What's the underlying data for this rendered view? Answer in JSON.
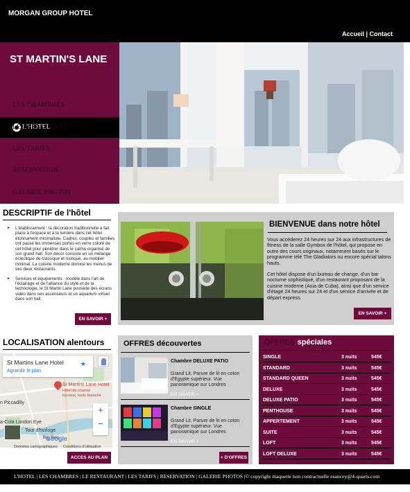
{
  "header": {
    "brand": "MORGAN GROUP HOTEL",
    "links": [
      "Accueil",
      "Contact"
    ],
    "separator": " | "
  },
  "sidebar": {
    "title": "ST MARTIN'S LANE",
    "active": "L'HOTEL",
    "items": [
      "LES CHAMBRES",
      "LE RESTAURANT",
      "LES TARIFS",
      "RESERVATION",
      "GALERIE PHOTOS"
    ]
  },
  "descriptif": {
    "title_main": "DESCRIPTIF",
    "title_rest": " de l'hôtel",
    "bullets": [
      "L'établissement : la décoration traditionnelle a fait place à l'espace et à la lumière dans cet hôtel étonnament minimaliste. Cadres, couples et familles ont passé les immenses portes en verre coloré de cet hôtel pour pénétrer dans le calme organisé de son grand hall. Son décor consiste en un mélange éclectique de classique et rustique, au mobilier minimal. La cuisine moderne domine les menus de ses deux restaurants.",
      "Services et équipements : modèle dans l'art de l'éclairage et de l'alliance du style et de la technologie, le St Martin Lane possède des écrans vidéo dans ses ascenseurs et un aquarium virtuel dans son hall."
    ],
    "button": "EN SAVOIR +"
  },
  "welcome": {
    "title": "BIENVENUE dans notre hôtel",
    "para1": "Vous accéderez 24 heures sur 24 aux infrastructures de fitness de la salle Gymbox de l'hôtel, qui propose en outre des cours originaux, notamment basés sur le programme télé The Gladiators ou encore spécial talons hauts.",
    "para2": "Cet hôtel dispose d'un bureau de change, d'un bar nocturne sophistiqué, d'un restaurant proposant de la cuisine moderne (Asia de Cuba), ainsi que d'un service d'étage 24 heures sur 24 et d'un service d'arrivée et de départ express.",
    "button": "EN SAVOIR +"
  },
  "localisation": {
    "title": "LOCALISATION alentours",
    "map_place": "St Martins Lane Hotel",
    "map_enlarge": "Agrandir le plan",
    "pin_title": "St Martins Lane Hotel",
    "pin_sub1": "Hôtel de charme",
    "pin_sub2": "luxueux, resto branché",
    "labels": [
      "n Piccadilly",
      "a-Cola London Eye",
      "Tour d'horloge",
      "Big Ben"
    ],
    "logo": "Google",
    "footnote1": "Données cartographiques",
    "footnote2": "Conditions d'utilisation",
    "button": "ACCES AU PLAN"
  },
  "offres": {
    "title": "OFFRES découvertes",
    "items": [
      {
        "name": "Chambre DELUXE PATIO",
        "desc": "Grand Lit. Parure de lit en coton d'Egypte supérieur. Vue panoramique sur Londres",
        "more": "EN SAVOIR +"
      },
      {
        "name": "Chambre SINGLE",
        "desc": "Grand Lit. Parure de lit en coton d'Egypte supérieur. Vue panoramique sur Londres",
        "more": "EN SAVOIR +"
      }
    ],
    "button": "+ D'OFFRES"
  },
  "specials": {
    "title_pre": "OFFRES",
    "title_main": " spéciales",
    "rows": [
      {
        "name": "SINGLE",
        "nights": "3 nuits",
        "price": "545€"
      },
      {
        "name": "STANDARD",
        "nights": "3 nuits",
        "price": "545€"
      },
      {
        "name": "STANDARD QUEEN",
        "nights": "3 nuits",
        "price": "545€"
      },
      {
        "name": "DELUXE",
        "nights": "3 nuits",
        "price": "545€"
      },
      {
        "name": "DELUXE PATIO",
        "nights": "3 nuits",
        "price": "545€"
      },
      {
        "name": "PENTHOUSE",
        "nights": "3 nuits",
        "price": "545€"
      },
      {
        "name": "APPERTEMENT",
        "nights": "3 nuits",
        "price": "545€"
      },
      {
        "name": "SUITE",
        "nights": "3 nuits",
        "price": "545€"
      },
      {
        "name": "LOFT",
        "nights": "3 nuits",
        "price": "545€"
      },
      {
        "name": "LOFT DELUXE",
        "nights": "3 nuits",
        "price": "545€"
      }
    ]
  },
  "footer": {
    "links": [
      "L'HOTEL",
      "LES CHAMBRES",
      "LE RESTAURANT",
      "LES TARIFS",
      "RESERVATION",
      "GALERIE PHOTOS"
    ],
    "copyright": "© copyright maquette non contractuelle esancey@4-quarts.com"
  },
  "colors": {
    "accent": "#6d0b3d",
    "dark": "#000000",
    "panel": "#cfcfcf"
  }
}
